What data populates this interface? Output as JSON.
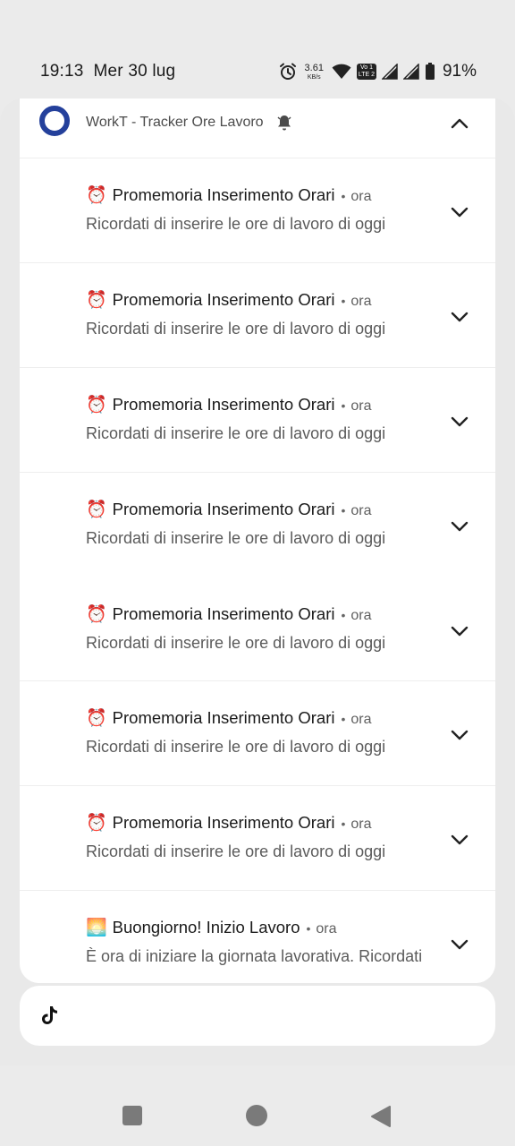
{
  "status_bar": {
    "time": "19:13",
    "date": "Mer 30 lug",
    "net_speed_value": "3.61",
    "net_speed_unit": "KB/s",
    "volte_label_1": "Vo 1",
    "volte_label_2": "LTE 2",
    "battery_percent": "91%",
    "icons": [
      "alarm-icon",
      "wifi-icon",
      "volte-icon",
      "signal-icon-1",
      "signal-icon-2",
      "battery-icon"
    ]
  },
  "group": {
    "app_name": "WorkT - Tracker Ore Lavoro",
    "icons": [
      "app-icon",
      "bell-icon",
      "chevron-up-icon"
    ]
  },
  "notifications": [
    {
      "emoji": "⏰",
      "title": "Promemoria Inserimento Orari",
      "time": "ora",
      "body": "Ricordati di inserire le ore di lavoro di oggi"
    },
    {
      "emoji": "⏰",
      "title": "Promemoria Inserimento Orari",
      "time": "ora",
      "body": "Ricordati di inserire le ore di lavoro di oggi"
    },
    {
      "emoji": "⏰",
      "title": "Promemoria Inserimento Orari",
      "time": "ora",
      "body": "Ricordati di inserire le ore di lavoro di oggi"
    },
    {
      "emoji": "⏰",
      "title": "Promemoria Inserimento Orari",
      "time": "ora",
      "body": "Ricordati di inserire le ore di lavoro di oggi"
    },
    {
      "emoji": "⏰",
      "title": "Promemoria Inserimento Orari",
      "time": "ora",
      "body": "Ricordati di inserire le ore di lavoro di oggi"
    },
    {
      "emoji": "⏰",
      "title": "Promemoria Inserimento Orari",
      "time": "ora",
      "body": "Ricordati di inserire le ore di lavoro di oggi"
    },
    {
      "emoji": "⏰",
      "title": "Promemoria Inserimento Orari",
      "time": "ora",
      "body": "Ricordati di inserire le ore di lavoro di oggi"
    },
    {
      "emoji": "🌅",
      "title": "Buongiorno! Inizio Lavoro",
      "time": "ora",
      "body": "È ora di iniziare la giornata lavorativa. Ricordati"
    }
  ],
  "other_notifications": [
    {
      "icon": "tiktok-icon"
    }
  ],
  "nav_bar": {
    "icons": [
      "recents-icon",
      "home-icon",
      "back-icon"
    ]
  },
  "colors": {
    "app_icon_ring": "#24409b",
    "card_background": "#ffffff",
    "panel_background": "#e9e9e9"
  }
}
